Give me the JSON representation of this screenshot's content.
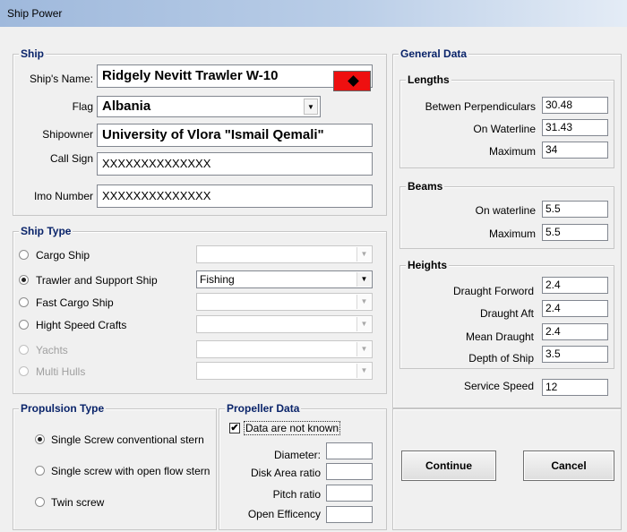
{
  "window": {
    "title": "Ship Power"
  },
  "ship": {
    "group_title": "Ship",
    "name_label": "Ship's Name:",
    "name_value": "Ridgely Nevitt Trawler W-10",
    "flag_label": "Flag",
    "flag_value": "Albania",
    "owner_label": "Shipowner",
    "owner_value": "University of Vlora \"Ismail Qemali\"",
    "call_label": "Call Sign",
    "call_value": "XXXXXXXXXXXXXX",
    "imo_label": "Imo Number",
    "imo_value": "XXXXXXXXXXXXXX"
  },
  "ship_type": {
    "group_title": "Ship Type",
    "items": [
      {
        "label": "Cargo Ship",
        "combo_value": "",
        "selected": false,
        "enabled": true
      },
      {
        "label": "Trawler and Support Ship",
        "combo_value": "Fishing",
        "selected": true,
        "enabled": true
      },
      {
        "label": "Fast Cargo Ship",
        "combo_value": "",
        "selected": false,
        "enabled": true
      },
      {
        "label": "Hight Speed Crafts",
        "combo_value": "",
        "selected": false,
        "enabled": true
      },
      {
        "label": "Yachts",
        "combo_value": "",
        "selected": false,
        "enabled": false
      },
      {
        "label": "Multi Hulls",
        "combo_value": "",
        "selected": false,
        "enabled": false
      }
    ]
  },
  "propulsion": {
    "group_title": "Propulsion Type",
    "items": [
      {
        "label": "Single Screw conventional stern",
        "selected": true
      },
      {
        "label": "Single screw with open flow stern",
        "selected": false
      },
      {
        "label": "Twin screw",
        "selected": false
      }
    ]
  },
  "propeller": {
    "group_title": "Propeller Data",
    "unknown_label": "Data are not known",
    "unknown_checked": true,
    "diameter_label": "Diameter:",
    "disk_label": "Disk Area ratio",
    "pitch_label": "Pitch ratio",
    "eff_label": "Open Efficency",
    "diameter_value": "",
    "disk_value": "",
    "pitch_value": "",
    "eff_value": ""
  },
  "general": {
    "group_title": "General Data",
    "lengths": {
      "title": "Lengths",
      "bp_label": "Betwen Perpendiculars",
      "bp_value": "30.48",
      "wl_label": "On Waterline",
      "wl_value": "31.43",
      "max_label": "Maximum",
      "max_value": "34"
    },
    "beams": {
      "title": "Beams",
      "wl_label": "On waterline",
      "wl_value": "5.5",
      "max_label": "Maximum",
      "max_value": "5.5"
    },
    "heights": {
      "title": "Heights",
      "df_label": "Draught Forword",
      "df_value": "2.4",
      "da_label": "Draught Aft",
      "da_value": "2.4",
      "md_label": "Mean Draught",
      "md_value": "2.4",
      "depth_label": "Depth of Ship",
      "depth_value": "3.5"
    },
    "speed_label": "Service Speed",
    "speed_value": "12"
  },
  "buttons": {
    "continue": "Continue",
    "cancel": "Cancel"
  },
  "colors": {
    "title_accent": "#0a246a",
    "flag_red": "#ee1010"
  }
}
